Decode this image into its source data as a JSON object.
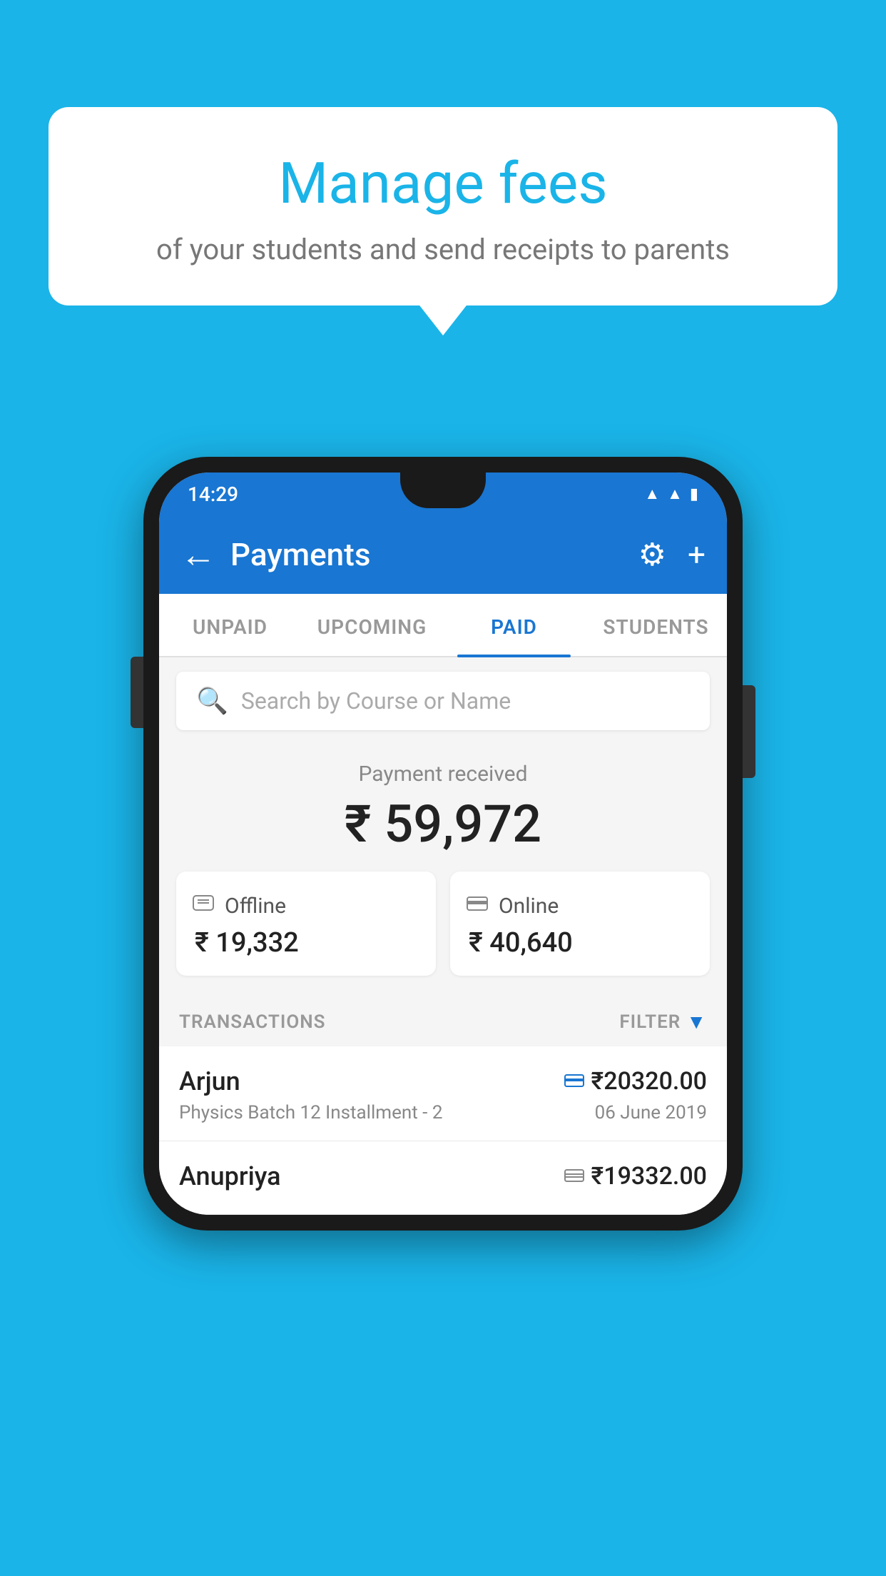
{
  "background_color": "#1ab4e8",
  "speech_bubble": {
    "title": "Manage fees",
    "subtitle": "of your students and send receipts to parents"
  },
  "phone": {
    "status_bar": {
      "time": "14:29",
      "icons": [
        "wifi",
        "signal",
        "battery"
      ]
    },
    "app_bar": {
      "title": "Payments",
      "back_label": "←",
      "settings_label": "⚙",
      "add_label": "+"
    },
    "tabs": [
      {
        "label": "UNPAID",
        "active": false
      },
      {
        "label": "UPCOMING",
        "active": false
      },
      {
        "label": "PAID",
        "active": true
      },
      {
        "label": "STUDENTS",
        "active": false
      }
    ],
    "search": {
      "placeholder": "Search by Course or Name"
    },
    "payment_summary": {
      "label": "Payment received",
      "amount": "₹ 59,972",
      "offline": {
        "label": "Offline",
        "amount": "₹ 19,332",
        "icon": "💳"
      },
      "online": {
        "label": "Online",
        "amount": "₹ 40,640",
        "icon": "💳"
      }
    },
    "transactions": {
      "header_label": "TRANSACTIONS",
      "filter_label": "FILTER",
      "rows": [
        {
          "name": "Arjun",
          "detail": "Physics Batch 12 Installment - 2",
          "amount": "₹20320.00",
          "date": "06 June 2019",
          "payment_type": "online"
        },
        {
          "name": "Anupriya",
          "detail": "",
          "amount": "₹19332.00",
          "date": "",
          "payment_type": "offline"
        }
      ]
    }
  }
}
